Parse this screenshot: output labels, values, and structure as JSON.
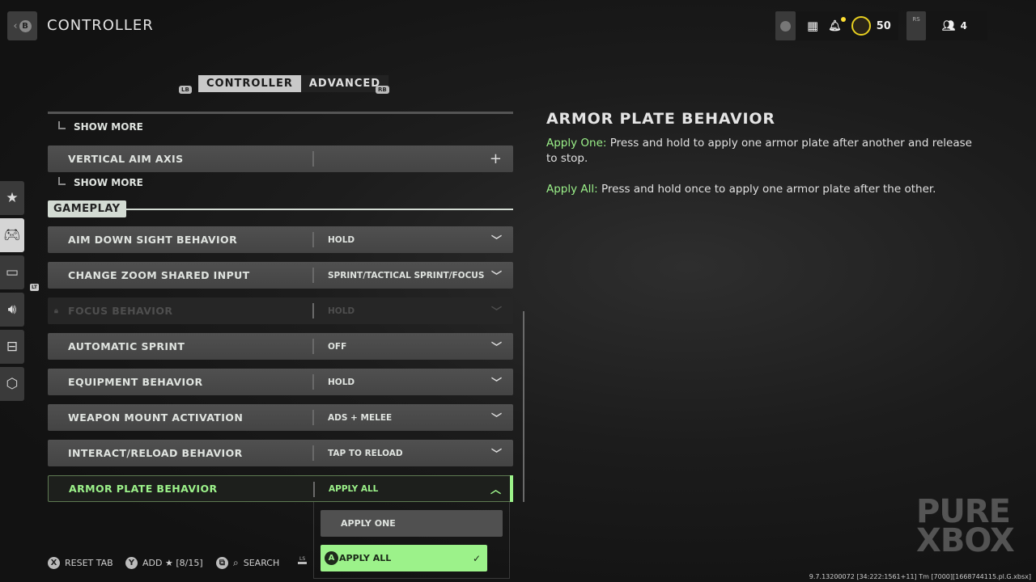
{
  "header": {
    "title": "CONTROLLER",
    "back_button": "B",
    "level": "50",
    "rs_label": "RS",
    "party_count": "4"
  },
  "tabs": {
    "lb": "LB",
    "rb": "RB",
    "items": [
      {
        "label": "CONTROLLER",
        "active": true
      },
      {
        "label": "ADVANCED",
        "active": false
      }
    ]
  },
  "list": {
    "show_more": "SHOW MORE",
    "vertical_aim_axis": "VERTICAL AIM AXIS",
    "section": "GAMEPLAY",
    "rows": [
      {
        "label": "AIM DOWN SIGHT BEHAVIOR",
        "value": "HOLD"
      },
      {
        "label": "CHANGE ZOOM SHARED INPUT",
        "value": "SPRINT/TACTICAL SPRINT/FOCUS"
      },
      {
        "label": "FOCUS BEHAVIOR",
        "value": "HOLD",
        "locked": true
      },
      {
        "label": "AUTOMATIC SPRINT",
        "value": "OFF"
      },
      {
        "label": "EQUIPMENT BEHAVIOR",
        "value": "HOLD"
      },
      {
        "label": "WEAPON MOUNT ACTIVATION",
        "value": "ADS + MELEE"
      },
      {
        "label": "INTERACT/RELOAD BEHAVIOR",
        "value": "TAP TO RELOAD"
      },
      {
        "label": "ARMOR PLATE BEHAVIOR",
        "value": "APPLY ALL",
        "expanded": true
      }
    ],
    "options": [
      "APPLY ONE",
      "APPLY ALL"
    ],
    "selected_option": "APPLY ALL",
    "a_button": "A"
  },
  "sidebar": {
    "items": [
      "favorites-icon",
      "controller-icon",
      "graphics-icon",
      "audio-icon",
      "interface-icon",
      "network-icon"
    ],
    "lt": "LT"
  },
  "detail": {
    "title": "ARMOR PLATE BEHAVIOR",
    "lines": [
      {
        "key": "Apply One:",
        "text": " Press and hold to apply one armor plate after another and release to stop."
      },
      {
        "key": "Apply All:",
        "text": " Press and hold once to apply one armor plate after the other."
      }
    ]
  },
  "footer": {
    "reset": "RESET TAB",
    "add": "ADD ★ [8/15]",
    "search": "SEARCH",
    "x": "X",
    "y": "Y",
    "ls": "LS"
  },
  "build": "9.7.13200072 [34:222:1561+11] Tm [7000][1668744115.pl.G.xbsx]",
  "watermark": "PURE XBOX",
  "colors": {
    "accent": "#9cf28a"
  }
}
